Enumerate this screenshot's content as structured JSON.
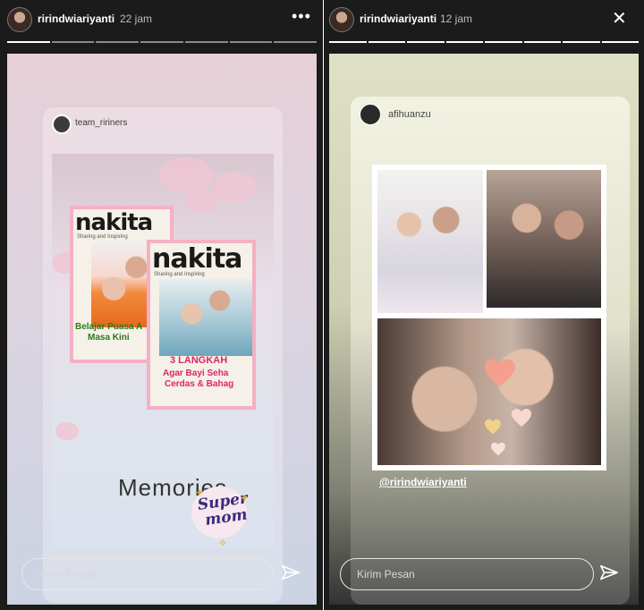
{
  "stories": [
    {
      "username": "ririndwiariyanti",
      "time": "22 jam",
      "progress_total": 7,
      "progress_active": 1,
      "repost": {
        "username": "team_ririners",
        "magazine_1": {
          "logo": "nakita",
          "tagline": "Sharing and Inspiring",
          "headline": "Belajar Puasa A",
          "subline": "Masa Kini"
        },
        "magazine_2": {
          "logo": "nakita",
          "tagline": "Sharing and Inspiring",
          "headline": "3 LANGKAH",
          "subline": "Agar Bayi Seha",
          "subline2": "Cerdas & Bahag"
        },
        "caption": "Memories",
        "sticker_line1": "Super",
        "sticker_line2": "mom"
      },
      "reply_placeholder": "Kirim Pesan"
    },
    {
      "username": "ririndwiariyanti",
      "time": "12 jam",
      "progress_total": 8,
      "progress_active": 8,
      "repost": {
        "username": "afihuanzu",
        "mention": "@ririndwiariyanti"
      },
      "reply_placeholder": "Kirim Pesan"
    }
  ],
  "icons": {
    "more": "more-horizontal-icon",
    "close": "close-icon",
    "send": "send-icon"
  },
  "colors": {
    "magazine_frame": "#f4b0c4",
    "logo_orange": "#f18a18",
    "sticker_text": "#3a2b7a"
  }
}
